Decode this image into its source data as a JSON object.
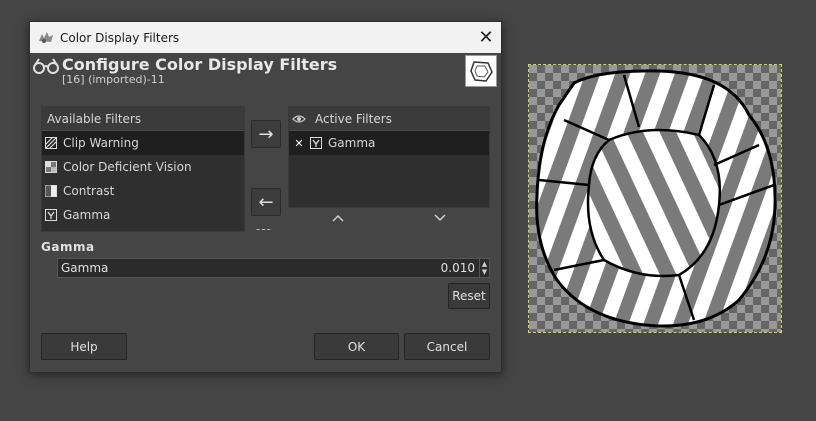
{
  "window": {
    "title": "Color Display Filters"
  },
  "header": {
    "title": "Configure Color Display Filters",
    "subtitle": "[16] (imported)-11"
  },
  "available": {
    "header": "Available Filters",
    "items": [
      {
        "label": "Clip Warning",
        "icon": "clip-warning-icon",
        "selected": true
      },
      {
        "label": "Color Deficient Vision",
        "icon": "color-deficient-vision-icon",
        "selected": false
      },
      {
        "label": "Contrast",
        "icon": "contrast-icon",
        "selected": false
      },
      {
        "label": "Gamma",
        "icon": "gamma-icon",
        "selected": false
      }
    ]
  },
  "active": {
    "header": "Active Filters",
    "items": [
      {
        "label": "Gamma",
        "icon": "gamma-icon",
        "enabled": true
      }
    ]
  },
  "arrows": {
    "add": "→",
    "remove": "←",
    "dashes": "---",
    "up": "^",
    "down": "v"
  },
  "gamma": {
    "section_label": "Gamma",
    "field_label": "Gamma",
    "value": "0.010"
  },
  "buttons": {
    "reset": "Reset",
    "help": "Help",
    "ok": "OK",
    "cancel": "Cancel"
  },
  "colors": {
    "dialog_bg": "#454545",
    "list_bg": "#2f2f2f",
    "selected_row": "#1f1f1f",
    "selection_outline": "#d8d83a"
  }
}
